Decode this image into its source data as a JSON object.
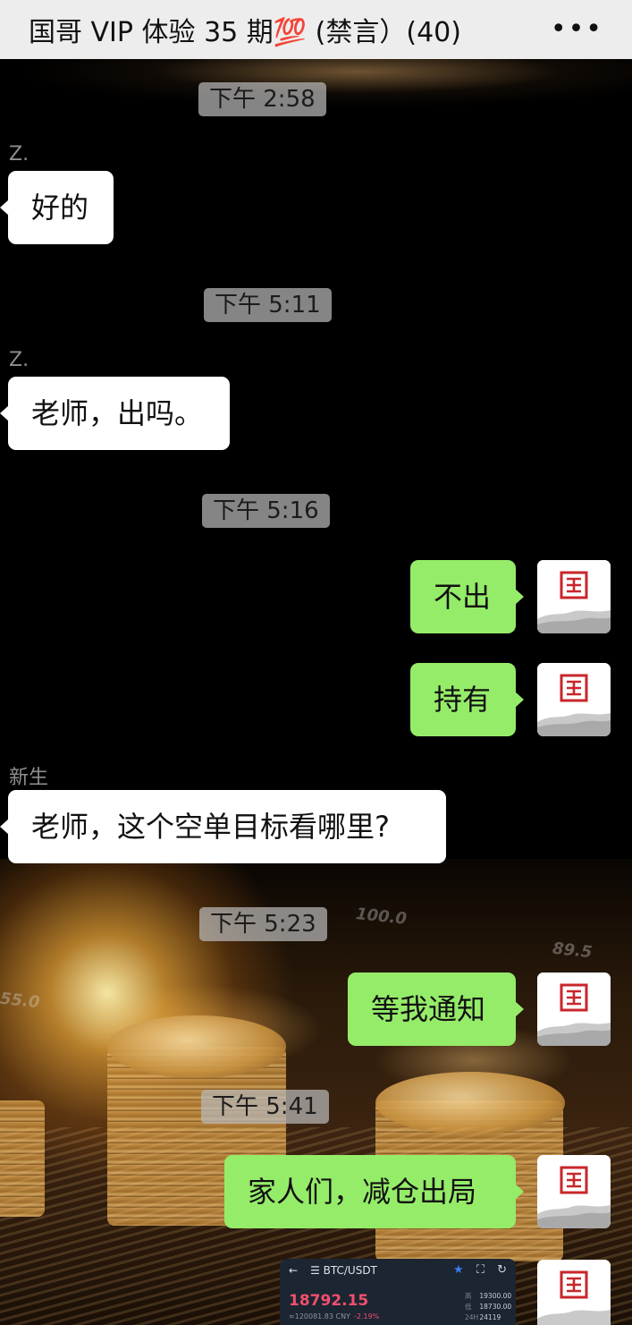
{
  "header": {
    "title": "国哥 VIP 体验 35 期💯 (禁言）(40)",
    "more_label": "•••"
  },
  "messages": [
    {
      "type": "time",
      "text": "下午 2:58"
    },
    {
      "type": "sender",
      "text": "Z."
    },
    {
      "type": "incoming",
      "text": "好的"
    },
    {
      "type": "time",
      "text": "下午 5:11"
    },
    {
      "type": "sender",
      "text": "Z."
    },
    {
      "type": "incoming",
      "text": "老师，出吗。"
    },
    {
      "type": "time",
      "text": "下午 5:16"
    },
    {
      "type": "outgoing",
      "text": "不出"
    },
    {
      "type": "outgoing",
      "text": "持有"
    },
    {
      "type": "sender",
      "text": "新生"
    },
    {
      "type": "incoming",
      "text": "老师，这个空单目标看哪里?"
    },
    {
      "type": "time",
      "text": "下午 5:23"
    },
    {
      "type": "outgoing",
      "text": "等我通知"
    },
    {
      "type": "time",
      "text": "下午 5:41"
    },
    {
      "type": "outgoing",
      "text": "家人们，减仓出局"
    }
  ],
  "trade_card": {
    "back_icon": "←",
    "pair": "☰ BTC/USDT",
    "star_icon": "★",
    "expand_icon": "⛶",
    "share_icon": "↻",
    "price": "18792.15",
    "cny": "≈120081.83 CNY",
    "change": "-2.19%",
    "high_label": "高",
    "high": "19300.00",
    "low_label": "低",
    "low": "18730.00",
    "vol_label": "24H",
    "vol": "24119"
  },
  "background_text": {
    "label_1": "100.0",
    "label_2": "89.5",
    "label_3": "55.0"
  },
  "colors": {
    "header_bg": "#ededed",
    "incoming_bubble": "#ffffff",
    "outgoing_bubble": "#95ec69",
    "timestamp_bg": "#b9b9b9",
    "avatar_seal": "#c8262b",
    "trade_card_bg": "#1c2532",
    "price_red": "#f0506e"
  },
  "avatar": {
    "icon": "seal-logo-icon"
  }
}
